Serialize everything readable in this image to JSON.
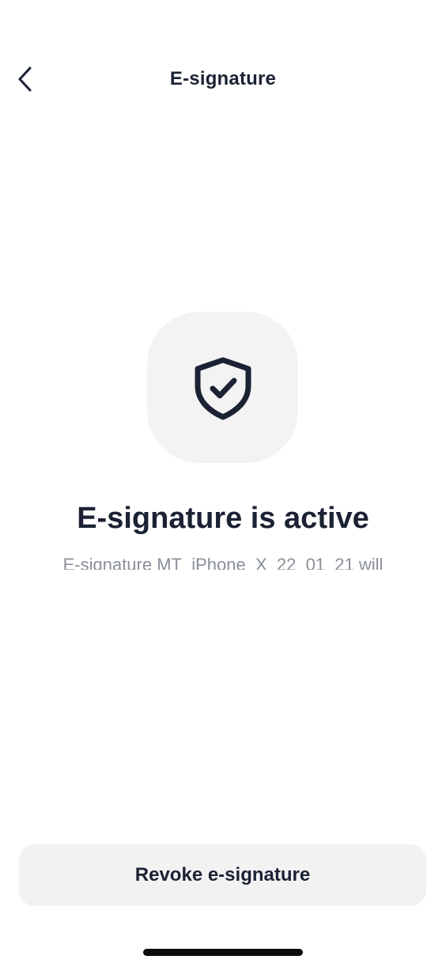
{
  "header": {
    "title": "E-signature",
    "back_icon": "chevron-left-icon"
  },
  "status": {
    "icon": "shield-check-icon",
    "title": "E-signature is active",
    "description": "E-signature MT_iPhone_X_22_01_21 will"
  },
  "actions": {
    "revoke_label": "Revoke e-signature"
  },
  "colors": {
    "text_primary": "#1a2233",
    "text_secondary": "#8a8f99",
    "tile_background": "#f3f3f4",
    "button_background": "#f2f2f3"
  }
}
